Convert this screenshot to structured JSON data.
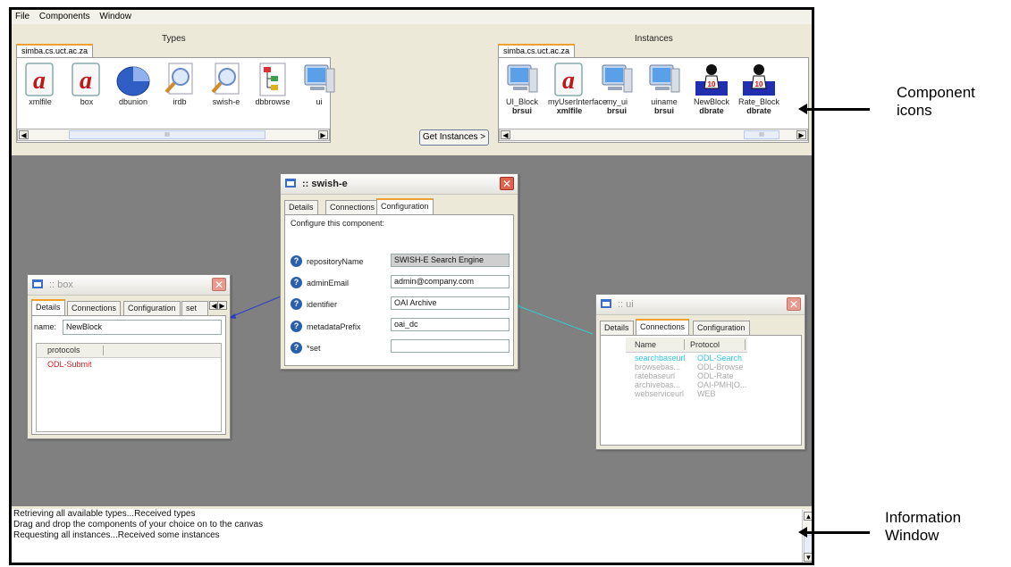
{
  "menu": [
    "File",
    "Components",
    "Window"
  ],
  "types_panel": {
    "title": "Types",
    "tab": "simba.cs.uct.ac.za",
    "icons": [
      {
        "label": "xmlfile",
        "icon": "red-a-document-icon"
      },
      {
        "label": "box",
        "icon": "red-a-document-icon"
      },
      {
        "label": "dbunion",
        "icon": "pie-disc-icon"
      },
      {
        "label": "irdb",
        "icon": "magnifier-document-icon"
      },
      {
        "label": "swish-e",
        "icon": "magnifier-document-icon"
      },
      {
        "label": "dbbrowse",
        "icon": "tree-document-icon"
      },
      {
        "label": "ui",
        "icon": "computer-monitor-icon"
      }
    ]
  },
  "instances_panel": {
    "title": "Instances",
    "tab": "simba.cs.uct.ac.za",
    "icons": [
      {
        "label": "UI_Block",
        "sub": "brsui",
        "icon": "computer-monitor-icon"
      },
      {
        "label": "myUserInterface",
        "sub": "xmlfile",
        "icon": "red-a-document-icon"
      },
      {
        "label": "my_ui",
        "sub": "brsui",
        "icon": "computer-monitor-icon"
      },
      {
        "label": "uiname",
        "sub": "brsui",
        "icon": "computer-monitor-icon"
      },
      {
        "label": "NewBlock",
        "sub": "dbrate",
        "icon": "rating-figure-icon"
      },
      {
        "label": "Rate_Block",
        "sub": "dbrate",
        "icon": "rating-figure-icon"
      }
    ]
  },
  "get_instances_button": "Get Instances >",
  "swish_window": {
    "title": ":: swish-e",
    "tabs": [
      "Details",
      "Connections",
      "Configuration"
    ],
    "active_tab": "Configuration",
    "intro": "Configure this component:",
    "fields": [
      {
        "label": "repositoryName",
        "value": "SWISH-E Search Engine"
      },
      {
        "label": "adminEmail",
        "value": "admin@company.com"
      },
      {
        "label": "identifier",
        "value": "OAI Archive"
      },
      {
        "label": "metadataPrefix",
        "value": "oai_dc"
      },
      {
        "label": "*set",
        "value": ""
      }
    ]
  },
  "box_window": {
    "title": ":: box",
    "tabs": [
      "Details",
      "Connections",
      "Configuration",
      "set"
    ],
    "active_tab": "Details",
    "name_label": "name:",
    "name_value": "NewBlock",
    "list_header": "protocols",
    "list_items": [
      "ODL-Submit"
    ]
  },
  "ui_window": {
    "title": ":: ui",
    "tabs": [
      "Details",
      "Connections",
      "Configuration"
    ],
    "active_tab": "Connections",
    "columns": [
      "Name",
      "Protocol"
    ],
    "rows": [
      {
        "name": "searchbaseurl",
        "protocol": "ODL-Search",
        "highlight": true
      },
      {
        "name": "browsebas...",
        "protocol": "ODL-Browse",
        "highlight": false
      },
      {
        "name": "ratebaseurl",
        "protocol": "ODL-Rate",
        "highlight": false
      },
      {
        "name": "archivebas...",
        "protocol": "OAI-PMH|O...",
        "highlight": false
      },
      {
        "name": "webserviceurl",
        "protocol": "WEB",
        "highlight": false
      }
    ]
  },
  "info_lines": [
    "Retrieving all available types...Received types",
    "Drag and drop the components of your choice on to the canvas",
    "Requesting all instances...Received some instances"
  ],
  "annotations": {
    "component_icons_line1": "Component",
    "component_icons_line2": "icons",
    "info_window_line1": "Information",
    "info_window_line2": "Window"
  },
  "colors": {
    "canvas": "#808080",
    "link_blue": "#2a3fd0",
    "link_cyan": "#33cccc",
    "highlight_text": "#33c6e0",
    "error_red": "#cc2222"
  }
}
